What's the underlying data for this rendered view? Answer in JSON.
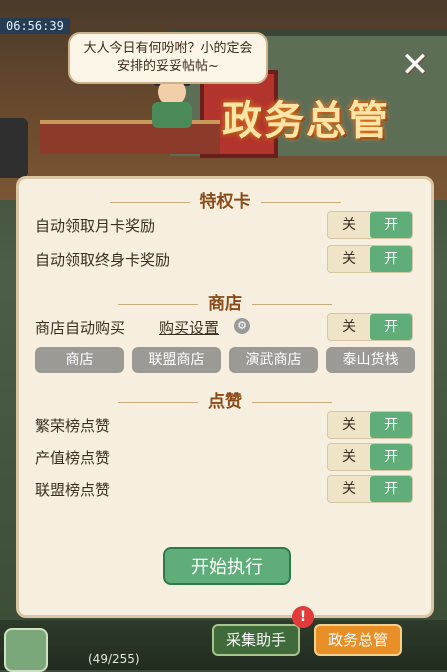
{
  "time": "06:56:39",
  "speech": "大人今日有何吩咐？小的定会安排的妥妥帖帖~",
  "header_title": "政务总管",
  "sections": {
    "privilege": {
      "title": "特权卡",
      "rows": [
        {
          "label": "自动领取月卡奖励",
          "off": "关",
          "on": "开",
          "state": "on"
        },
        {
          "label": "自动领取终身卡奖励",
          "off": "关",
          "on": "开",
          "state": "on"
        }
      ]
    },
    "shop": {
      "title": "商店",
      "auto_label": "商店自动购买",
      "settings_link": "购买设置",
      "off": "关",
      "on": "开",
      "state": "on",
      "tabs": [
        "商店",
        "联盟商店",
        "演武商店",
        "泰山货栈"
      ]
    },
    "like": {
      "title": "点赞",
      "rows": [
        {
          "label": "繁荣榜点赞",
          "off": "关",
          "on": "开",
          "state": "on"
        },
        {
          "label": "产值榜点赞",
          "off": "关",
          "on": "开",
          "state": "on"
        },
        {
          "label": "联盟榜点赞",
          "off": "关",
          "on": "开",
          "state": "on"
        }
      ]
    }
  },
  "start_button": "开始执行",
  "bottom": {
    "collect_helper": "采集助手",
    "affairs_manager": "政务总管",
    "notice_badge": "!",
    "pager": "(49/255)"
  }
}
